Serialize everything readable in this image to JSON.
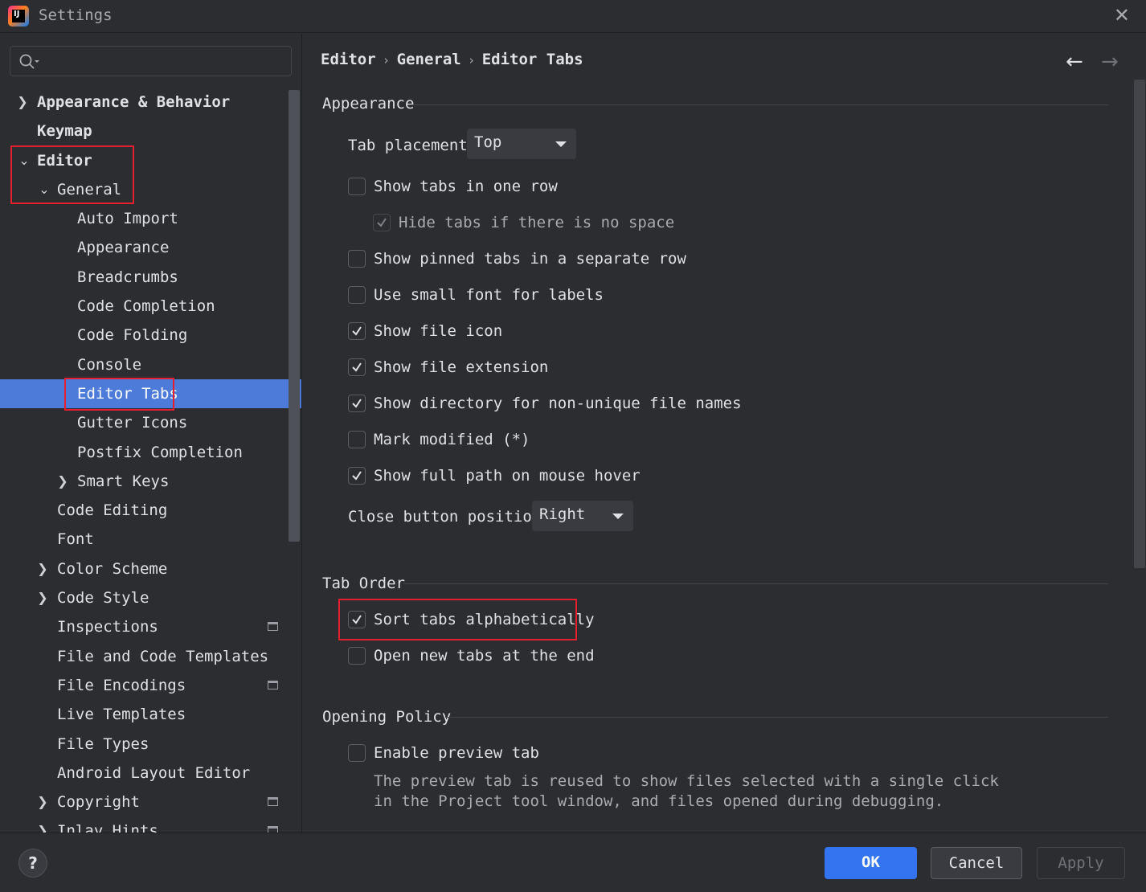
{
  "window": {
    "title": "Settings",
    "close": "✕"
  },
  "search": {
    "placeholder": ""
  },
  "tree": {
    "appearance_behavior": "Appearance & Behavior",
    "keymap": "Keymap",
    "editor": "Editor",
    "general": "General",
    "auto_import": "Auto Import",
    "appearance": "Appearance",
    "breadcrumbs": "Breadcrumbs",
    "code_completion": "Code Completion",
    "code_folding": "Code Folding",
    "console": "Console",
    "editor_tabs": "Editor Tabs",
    "gutter_icons": "Gutter Icons",
    "postfix_completion": "Postfix Completion",
    "smart_keys": "Smart Keys",
    "code_editing": "Code Editing",
    "font": "Font",
    "color_scheme": "Color Scheme",
    "code_style": "Code Style",
    "inspections": "Inspections",
    "file_code_templates": "File and Code Templates",
    "file_encodings": "File Encodings",
    "live_templates": "Live Templates",
    "file_types": "File Types",
    "android_layout_editor": "Android Layout Editor",
    "copyright": "Copyright",
    "inlay_hints": "Inlay Hints"
  },
  "breadcrumb": {
    "part1": "Editor",
    "part2": "General",
    "part3": "Editor Tabs",
    "sep": "›"
  },
  "nav": {
    "back": "←",
    "forward": "→"
  },
  "appearance": {
    "title": "Appearance",
    "tab_placement_label": "Tab placement:",
    "tab_placement_value": "Top",
    "show_tabs_one_row": "Show tabs in one row",
    "hide_tabs_no_space": "Hide tabs if there is no space",
    "show_pinned_separate": "Show pinned tabs in a separate row",
    "small_font": "Use small font for labels",
    "show_file_icon": "Show file icon",
    "show_file_extension": "Show file extension",
    "show_directory": "Show directory for non-unique file names",
    "mark_modified": "Mark modified (*)",
    "show_full_path": "Show full path on mouse hover",
    "close_button_label": "Close button position:",
    "close_button_value": "Right"
  },
  "tab_order": {
    "title": "Tab Order",
    "sort_alpha": "Sort tabs alphabetically",
    "open_at_end": "Open new tabs at the end"
  },
  "opening_policy": {
    "title": "Opening Policy",
    "enable_preview": "Enable preview tab",
    "desc_line1": "The preview tab is reused to show files selected with a single click",
    "desc_line2": "in the Project tool window, and files opened during debugging."
  },
  "footer": {
    "help": "?",
    "ok": "OK",
    "cancel": "Cancel",
    "apply": "Apply"
  }
}
